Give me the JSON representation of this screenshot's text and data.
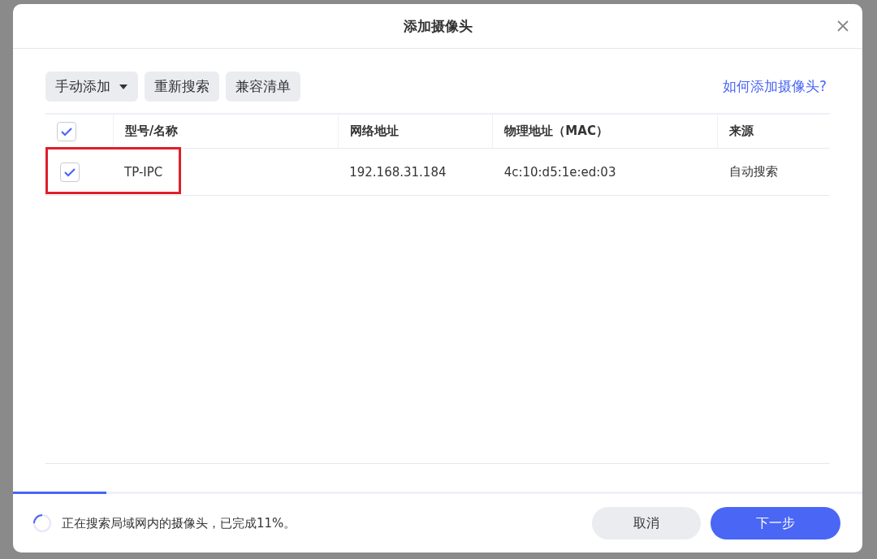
{
  "dialog": {
    "title": "添加摄像头"
  },
  "toolbar": {
    "buttons": [
      {
        "label": "手动添加",
        "kind": "dropdown"
      },
      {
        "label": "重新搜索",
        "kind": "plain"
      },
      {
        "label": "兼容清单",
        "kind": "plain"
      }
    ],
    "help_link": "如何添加摄像头?"
  },
  "table": {
    "select_all": {
      "checked": true
    },
    "columns": [
      "型号/名称",
      "网络地址",
      "物理地址（MAC）",
      "来源"
    ],
    "rows": [
      {
        "checked": true,
        "highlighted": true,
        "cells": [
          "TP-IPC",
          "192.168.31.184",
          "4c:10:d5:1e:ed:03",
          "自动搜索"
        ]
      }
    ]
  },
  "progress": {
    "level": 0.11,
    "status": "正在搜索局域网内的摄像头，已完成11%。"
  },
  "buttons": [
    {
      "label": "取消",
      "kind": "secondary"
    },
    {
      "label": "下一步",
      "kind": "primary"
    }
  ]
}
